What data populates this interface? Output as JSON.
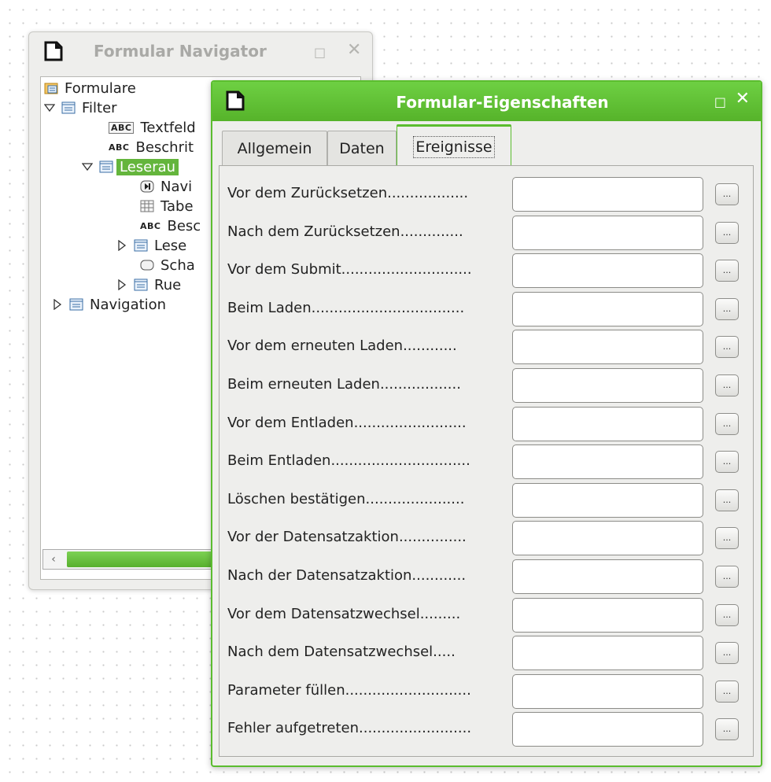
{
  "navigator": {
    "title": "Formular Navigator",
    "scroll_indicator": "III",
    "tree": [
      {
        "label": "Formulare"
      },
      {
        "label": "Filter"
      },
      {
        "label": "Textfeld",
        "icon_text": "ABC"
      },
      {
        "label": "Beschrit",
        "icon_text": "ABC"
      },
      {
        "label": "Leserau"
      },
      {
        "label": "Navi"
      },
      {
        "label": "Tabe"
      },
      {
        "label": "Besc",
        "icon_text": "ABC"
      },
      {
        "label": "Lese"
      },
      {
        "label": "Scha"
      },
      {
        "label": "Rue"
      },
      {
        "label": "Navigation"
      }
    ]
  },
  "dialog": {
    "title": "Formular-Eigenschaften",
    "tabs": [
      {
        "label": "Allgemein"
      },
      {
        "label": "Daten"
      },
      {
        "label": "Ereignisse"
      }
    ],
    "active_tab": "Ereignisse",
    "button_label": "...",
    "events": [
      {
        "label": "Vor dem Zurücksetzen..................",
        "value": ""
      },
      {
        "label": "Nach dem Zurücksetzen..............",
        "value": ""
      },
      {
        "label": "Vor dem Submit.............................",
        "value": ""
      },
      {
        "label": "Beim Laden..................................",
        "value": ""
      },
      {
        "label": "Vor dem erneuten Laden............",
        "value": ""
      },
      {
        "label": "Beim erneuten Laden..................",
        "value": ""
      },
      {
        "label": "Vor dem Entladen.........................",
        "value": ""
      },
      {
        "label": "Beim Entladen...............................",
        "value": ""
      },
      {
        "label": "Löschen bestätigen......................",
        "value": ""
      },
      {
        "label": "Vor der Datensatzaktion...............",
        "value": ""
      },
      {
        "label": "Nach der Datensatzaktion............",
        "value": ""
      },
      {
        "label": "Vor dem Datensatzwechsel.........",
        "value": ""
      },
      {
        "label": "Nach dem Datensatzwechsel.....",
        "value": ""
      },
      {
        "label": "Parameter füllen............................",
        "value": ""
      },
      {
        "label": "Fehler aufgetreten.........................",
        "value": ""
      }
    ]
  },
  "colors": {
    "accent": "#5bbd2f",
    "window_bg": "#eeeeec",
    "selection": "#64b53c"
  }
}
